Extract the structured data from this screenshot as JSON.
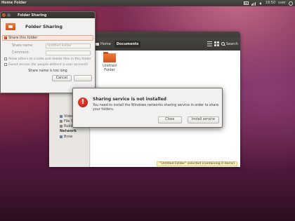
{
  "top_panel": {
    "app_title": "Home Folder",
    "time": "18:50",
    "user": "user"
  },
  "file_manager": {
    "path": {
      "home_label": "Home",
      "current_label": "Documents"
    },
    "search_label": "Search",
    "sidebar": {
      "items": [
        {
          "label": "Video",
          "icon": "video-icon",
          "color": "#6a7fb0"
        },
        {
          "label": "File S",
          "icon": "file-system-icon",
          "color": "#8a8782"
        },
        {
          "label": "Rubb",
          "icon": "trash-icon",
          "color": "#8a8782"
        }
      ],
      "network_heading": "Network",
      "network_items": [
        {
          "label": "Brow",
          "icon": "network-icon",
          "color": "#6a7fb0"
        }
      ]
    },
    "folder_label": "Untitled Folder",
    "status_text": "\"Untitled Folder\" selected (containing 0 items)"
  },
  "share_dialog": {
    "window_title": "Folder Sharing",
    "header_title": "Folder Sharing",
    "share_checkbox_label": "Share this folder",
    "share_name_label": "Share name:",
    "share_name_value": "Untitled Folder",
    "comment_label": "Comment:",
    "comment_value": "",
    "allow_others_label": "Allow others to create and delete files in this folder",
    "guest_access_label": "Guest access (for people without a user account)",
    "error_text": "Share name is too long",
    "cancel_label": "Cancel",
    "create_share_label": ""
  },
  "error_dialog": {
    "title": "Sharing service is not installed",
    "body": "You need to install the Windows networks sharing service in order to share your folders.",
    "close_label": "Close",
    "install_label": "Install service"
  },
  "colors": {
    "accent": "#dd4814",
    "error_red": "#cc1f12",
    "status_bg": "#fbf2b8"
  }
}
